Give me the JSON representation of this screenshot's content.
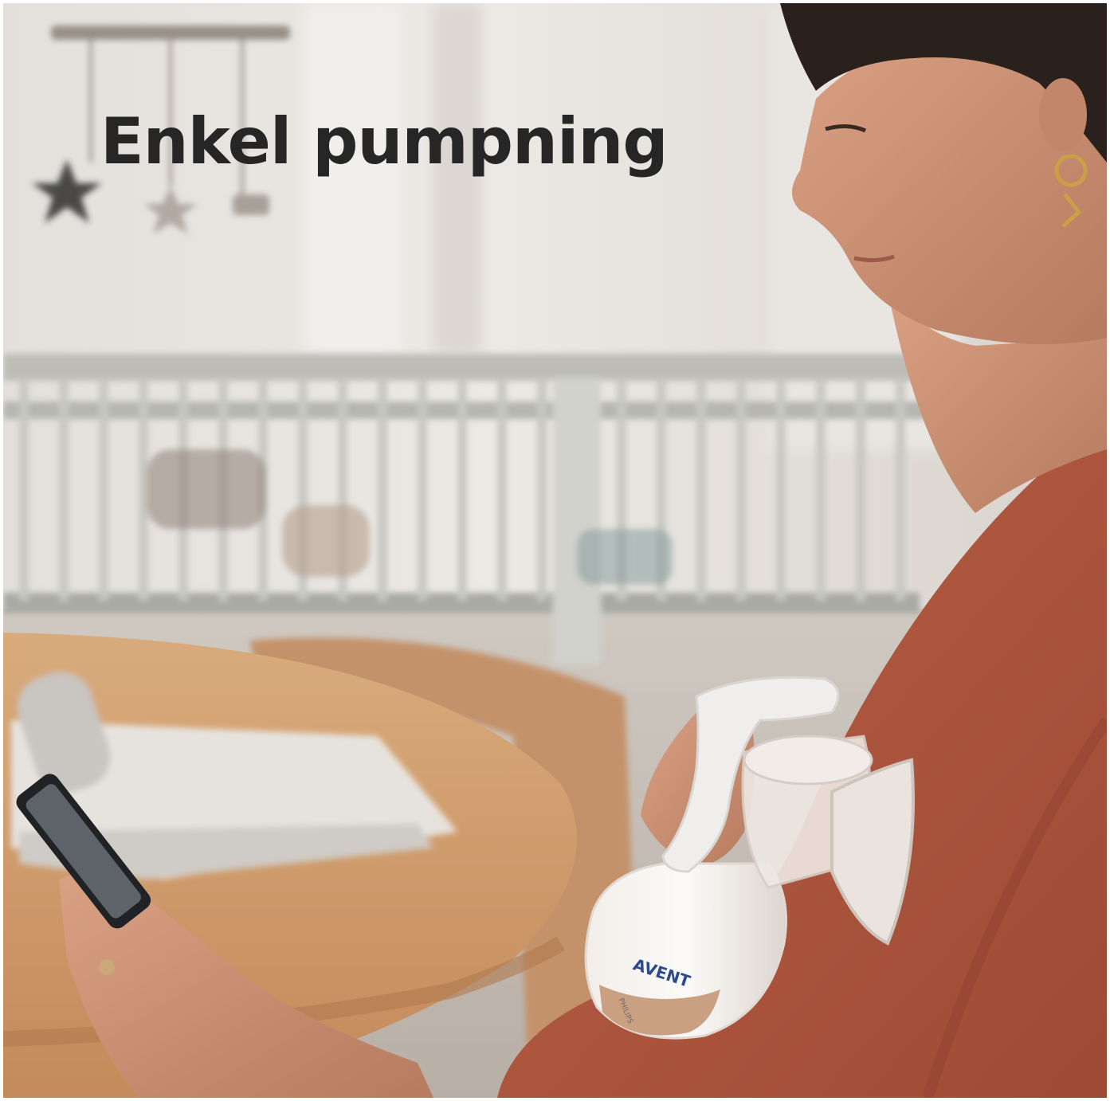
{
  "headline": "Enkel pumpning",
  "product": {
    "brand_logo_text": "AVENT",
    "maker_text": "PHILIPS"
  },
  "colors": {
    "headline_text": "#262626",
    "wall": "#e7e3df",
    "crib": "#b9bab4",
    "table": "#cf9a6a",
    "sweater": "#b1573f",
    "skin": "#c98d70",
    "milk": "#c9a081"
  }
}
